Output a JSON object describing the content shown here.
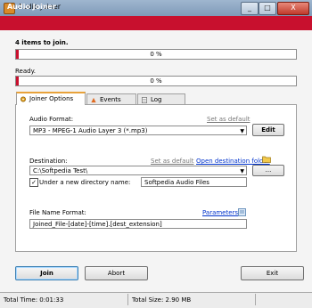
{
  "window": {
    "title": "Audio Joiner",
    "min": "_",
    "max": "□",
    "close": "X"
  },
  "header": {
    "title": "Audio Joiner"
  },
  "status": {
    "items_text": "4 items to join.",
    "progress1_text": "0 %",
    "ready_text": "Ready.",
    "progress2_text": "0 %",
    "progress1_value": 0.0,
    "progress2_value": 0.0
  },
  "tabs": [
    {
      "label": "Joiner Options",
      "icon": "gear-icon"
    },
    {
      "label": "Events",
      "icon": "events-icon"
    },
    {
      "label": "Log",
      "icon": "log-icon"
    }
  ],
  "options": {
    "audio_format_label": "Audio Format:",
    "audio_format_default_link": "Set as default",
    "audio_format_value": "MP3 - MPEG-1 Audio Layer 3 (*.mp3)",
    "edit_button": "Edit",
    "destination_label": "Destination:",
    "destination_default_link": "Set as default",
    "open_destination_link": "Open destination folder",
    "destination_value": "C:\\Softpedia Test\\",
    "browse_button": "...",
    "new_dir_checkbox_label": "Under a new directory name:",
    "new_dir_value": "Softpedia Audio Files",
    "filename_label": "File Name Format:",
    "parameters_link": "Parameters",
    "filename_value": "Joined_File-[date]-[time].[dest_extension]"
  },
  "buttons": {
    "join": "Join",
    "abort": "Abort",
    "exit": "Exit"
  },
  "statusbar": {
    "total_time": "Total Time: 0:01:33",
    "total_size": "Total Size: 2.90 MB"
  },
  "colors": {
    "accent": "#c8102e",
    "link": "#0033cc"
  }
}
